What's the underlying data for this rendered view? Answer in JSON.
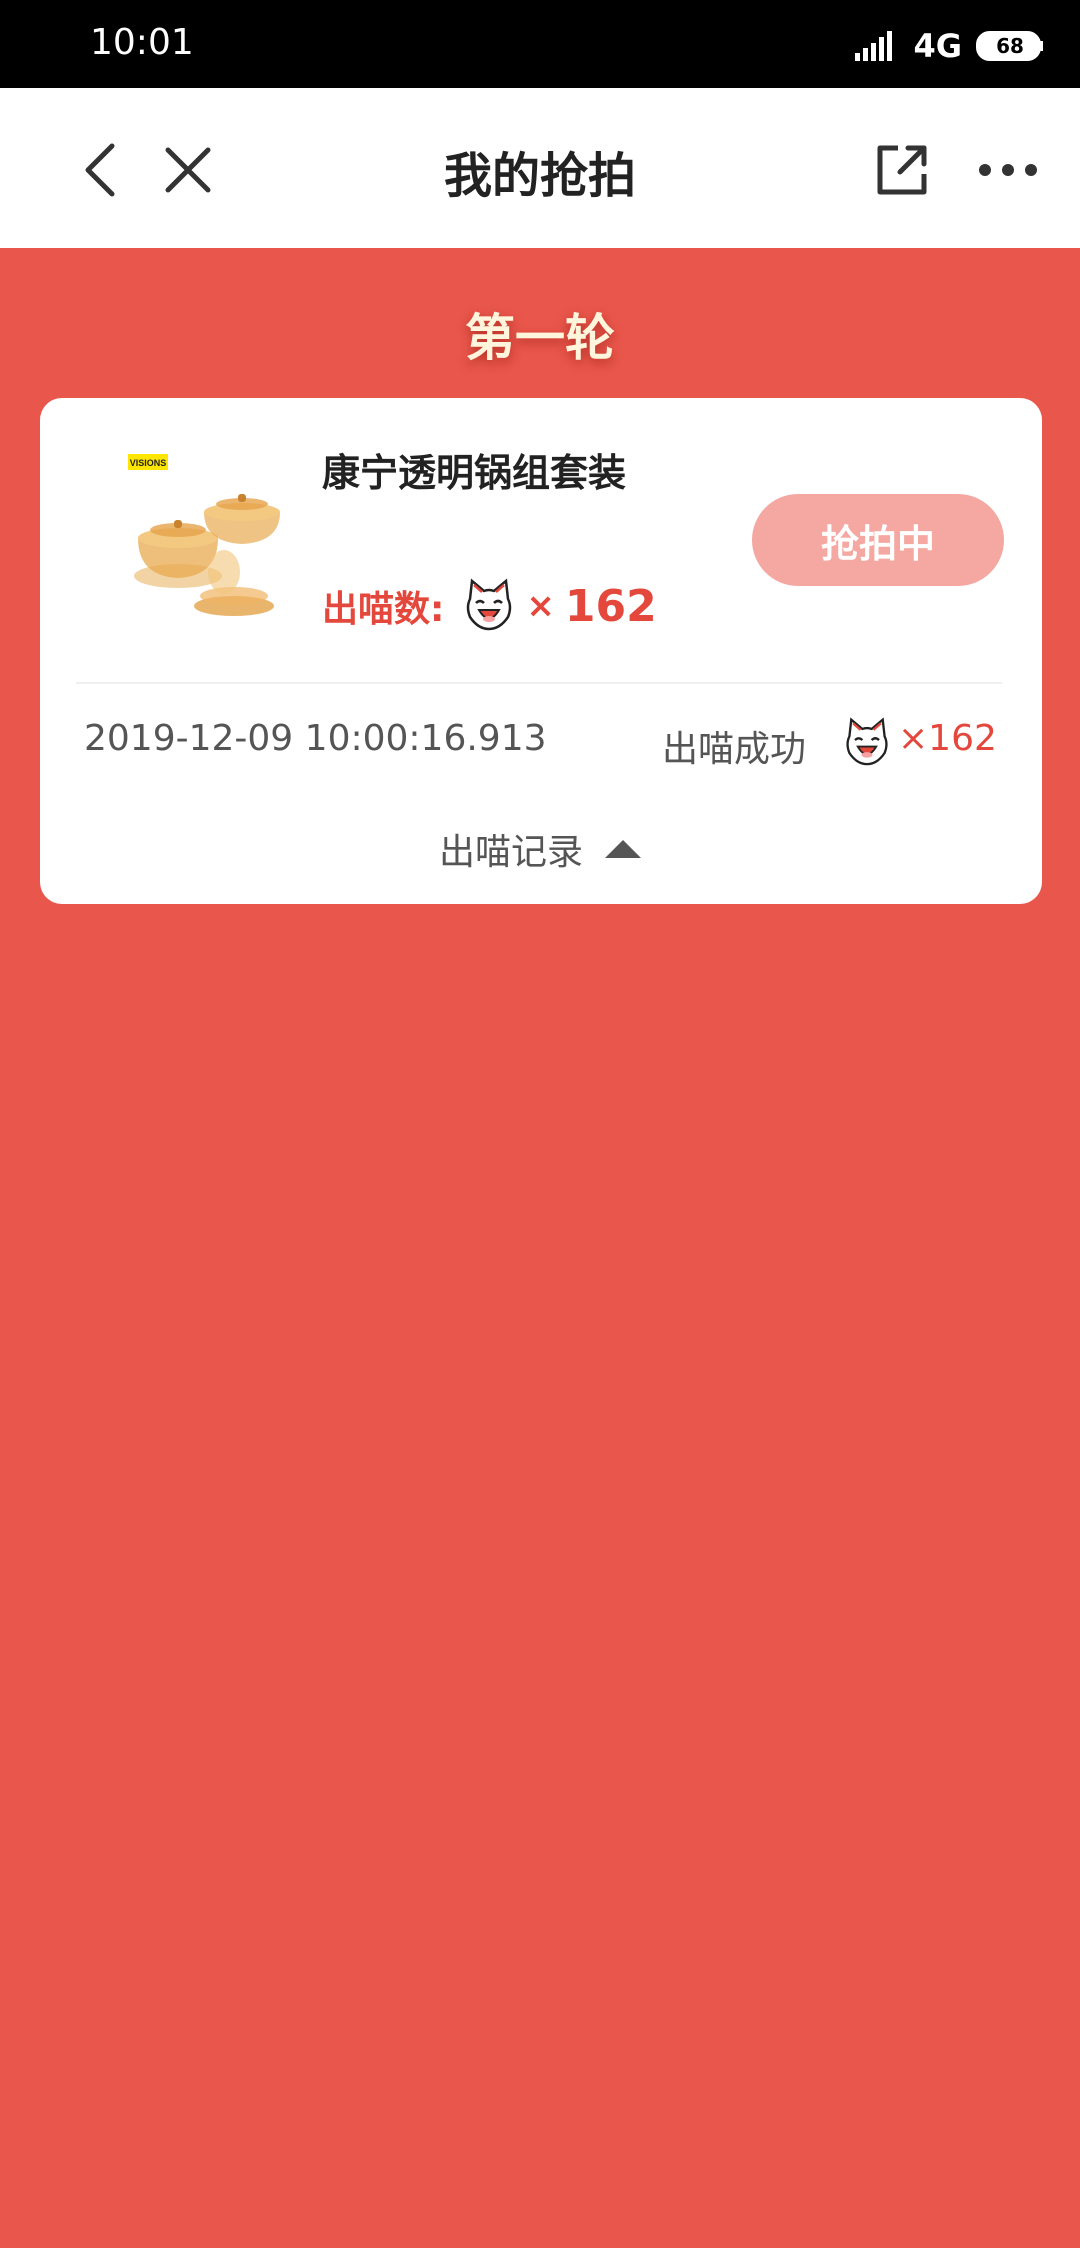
{
  "status_bar": {
    "time": "10:01",
    "network": "4G",
    "battery": "68",
    "icons": [
      "signal-icon",
      "battery-icon"
    ]
  },
  "nav": {
    "title": "我的抢拍",
    "icons": [
      "back-icon",
      "close-icon",
      "share-icon",
      "more-icon"
    ]
  },
  "round": {
    "title": "第一轮"
  },
  "product": {
    "name": "康宁透明锅组套装",
    "brand_logo": "VISIONS",
    "bid_label": "出喵数:",
    "bid_times": "×",
    "bid_count": "162",
    "status_button": "抢拍中"
  },
  "record": {
    "time": "2019-12-09 10:00:16.913",
    "status": "出喵成功",
    "count": "×162",
    "toggle_label": "出喵记录",
    "toggle_icon": "triangle-up-icon"
  },
  "colors": {
    "background": "#e9564b",
    "accent": "#e4473c",
    "button_disabled": "#f4a8a1",
    "round_title": "#fff5dc"
  }
}
